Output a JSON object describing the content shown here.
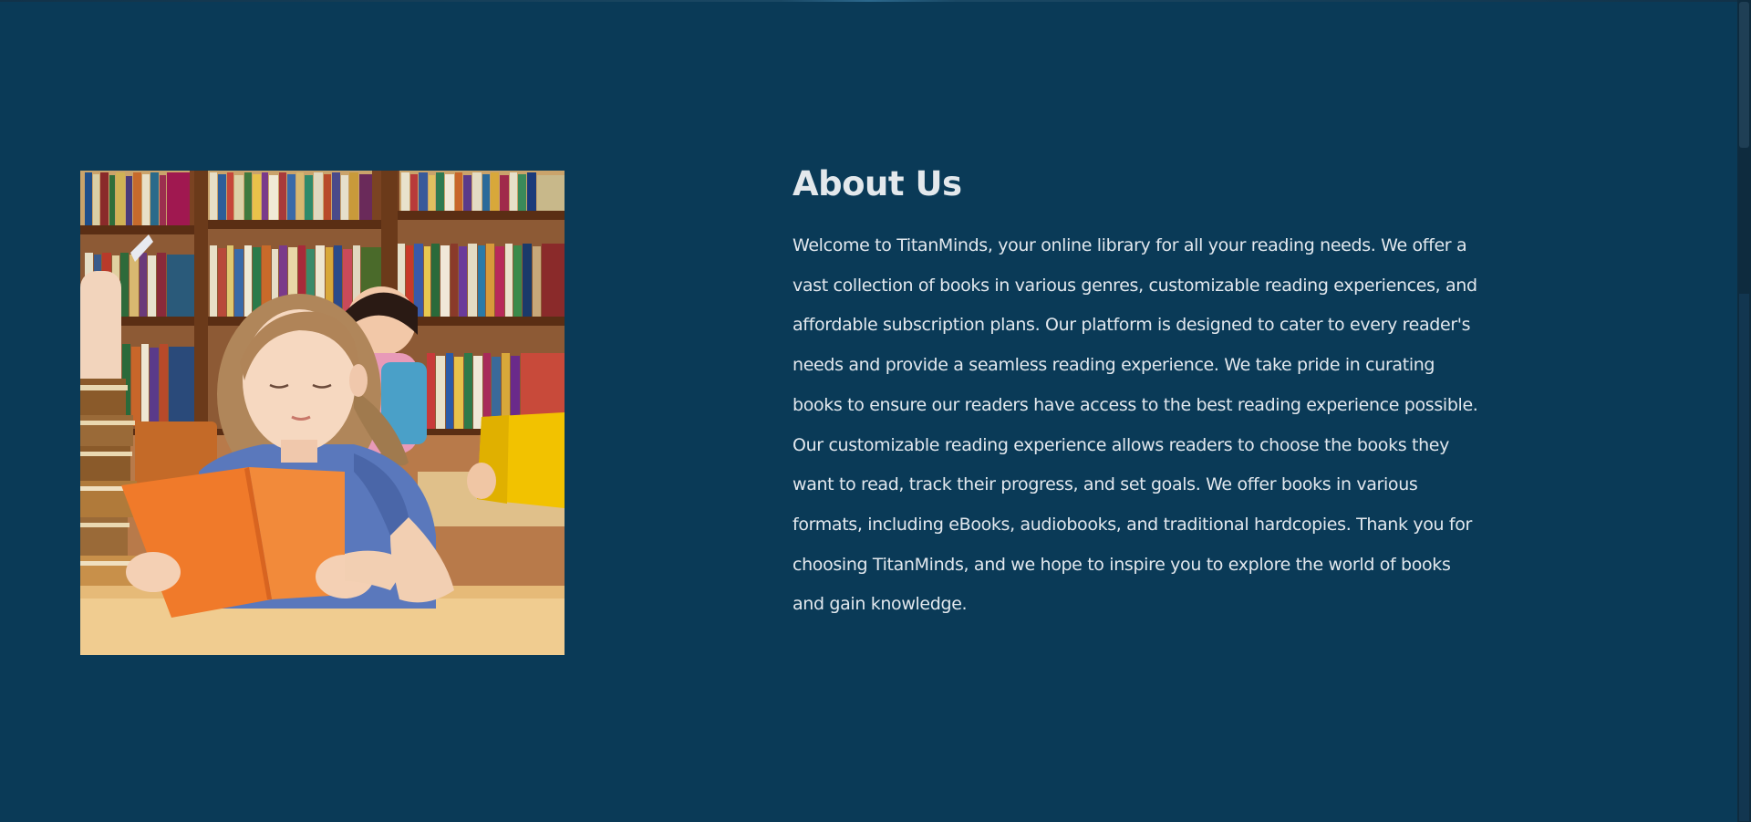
{
  "about": {
    "title": "About Us",
    "body": "Welcome to TitanMinds, your online library for all your reading needs. We offer a vast collection of books in various genres, customizable reading experiences, and affordable subscription plans. Our platform is designed to cater to every reader's needs and provide a seamless reading experience. We take pride in curating books to ensure our readers have access to the best reading experience possible. Our customizable reading experience allows readers to choose the books they want to read, track their progress, and set goals. We offer books in various formats, including eBooks, audiobooks, and traditional hardcopies. Thank you for choosing TitanMinds, and we hope to inspire you to explore the world of books and gain knowledge.",
    "image": "girl-reading-book-in-library"
  },
  "colors": {
    "background": "#0a3a57",
    "title": "#e3e8ec",
    "body_text": "#e2e8ee"
  }
}
